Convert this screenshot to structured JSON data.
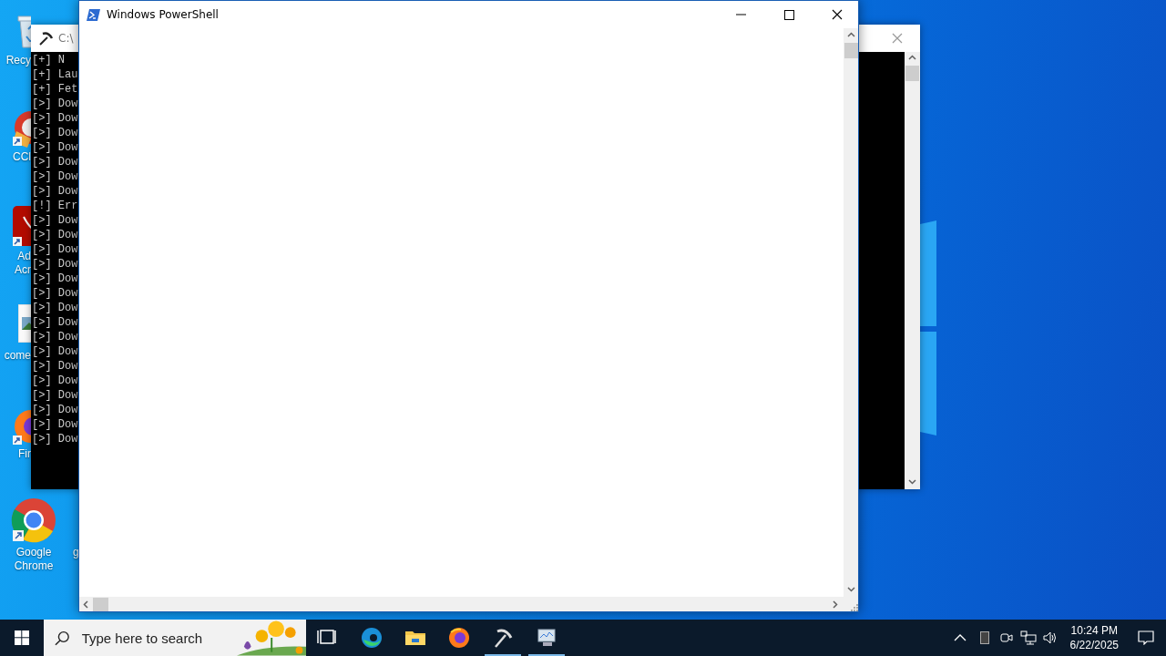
{
  "desktop": {
    "icons": [
      {
        "kind": "recycle-bin",
        "label": [
          "Recy"
        ]
      },
      {
        "kind": "cleaner",
        "label": [
          "CCl"
        ]
      },
      {
        "kind": "acrobat",
        "label": [
          "Ad",
          "Acr"
        ]
      },
      {
        "kind": "image-file",
        "label": [
          "come"
        ]
      },
      {
        "kind": "firefox",
        "label": [
          "Fir"
        ]
      },
      {
        "kind": "chrome",
        "label": [
          "Google",
          "Chrome"
        ]
      },
      {
        "kind": "covered",
        "label": [
          "g"
        ]
      }
    ]
  },
  "console_window": {
    "title": "C:\\",
    "lines": [
      "[+] N",
      "[+] Lau",
      "[+] Fet",
      "[>] Dow",
      "[>] Dow",
      "[>] Dow",
      "[>] Dow",
      "[>] Dow",
      "[>] Dow",
      "[>] Dow",
      "[!] Err",
      "[>] Dow",
      "[>] Dow",
      "[>] Dow",
      "[>] Dow",
      "[>] Dow",
      "[>] Dow",
      "[>] Dow",
      "[>] Dow",
      "[>] Dow",
      "[>] Dow",
      "[>] Dow",
      "[>] Dow",
      "[>] Dow",
      "[>] Dow",
      "[>] Dow",
      "[>] Dow"
    ]
  },
  "powershell_window": {
    "title": "Windows PowerShell"
  },
  "taskbar": {
    "search": {
      "placeholder": "Type here to search"
    },
    "apps": [
      {
        "kind": "task-view",
        "active": false
      },
      {
        "kind": "edge",
        "active": false
      },
      {
        "kind": "explorer",
        "active": false
      },
      {
        "kind": "firefox",
        "active": false
      },
      {
        "kind": "pickaxe",
        "active": true
      },
      {
        "kind": "monitor",
        "active": true
      }
    ],
    "clock": {
      "time": "10:24 PM",
      "date": "6/22/2025"
    }
  }
}
